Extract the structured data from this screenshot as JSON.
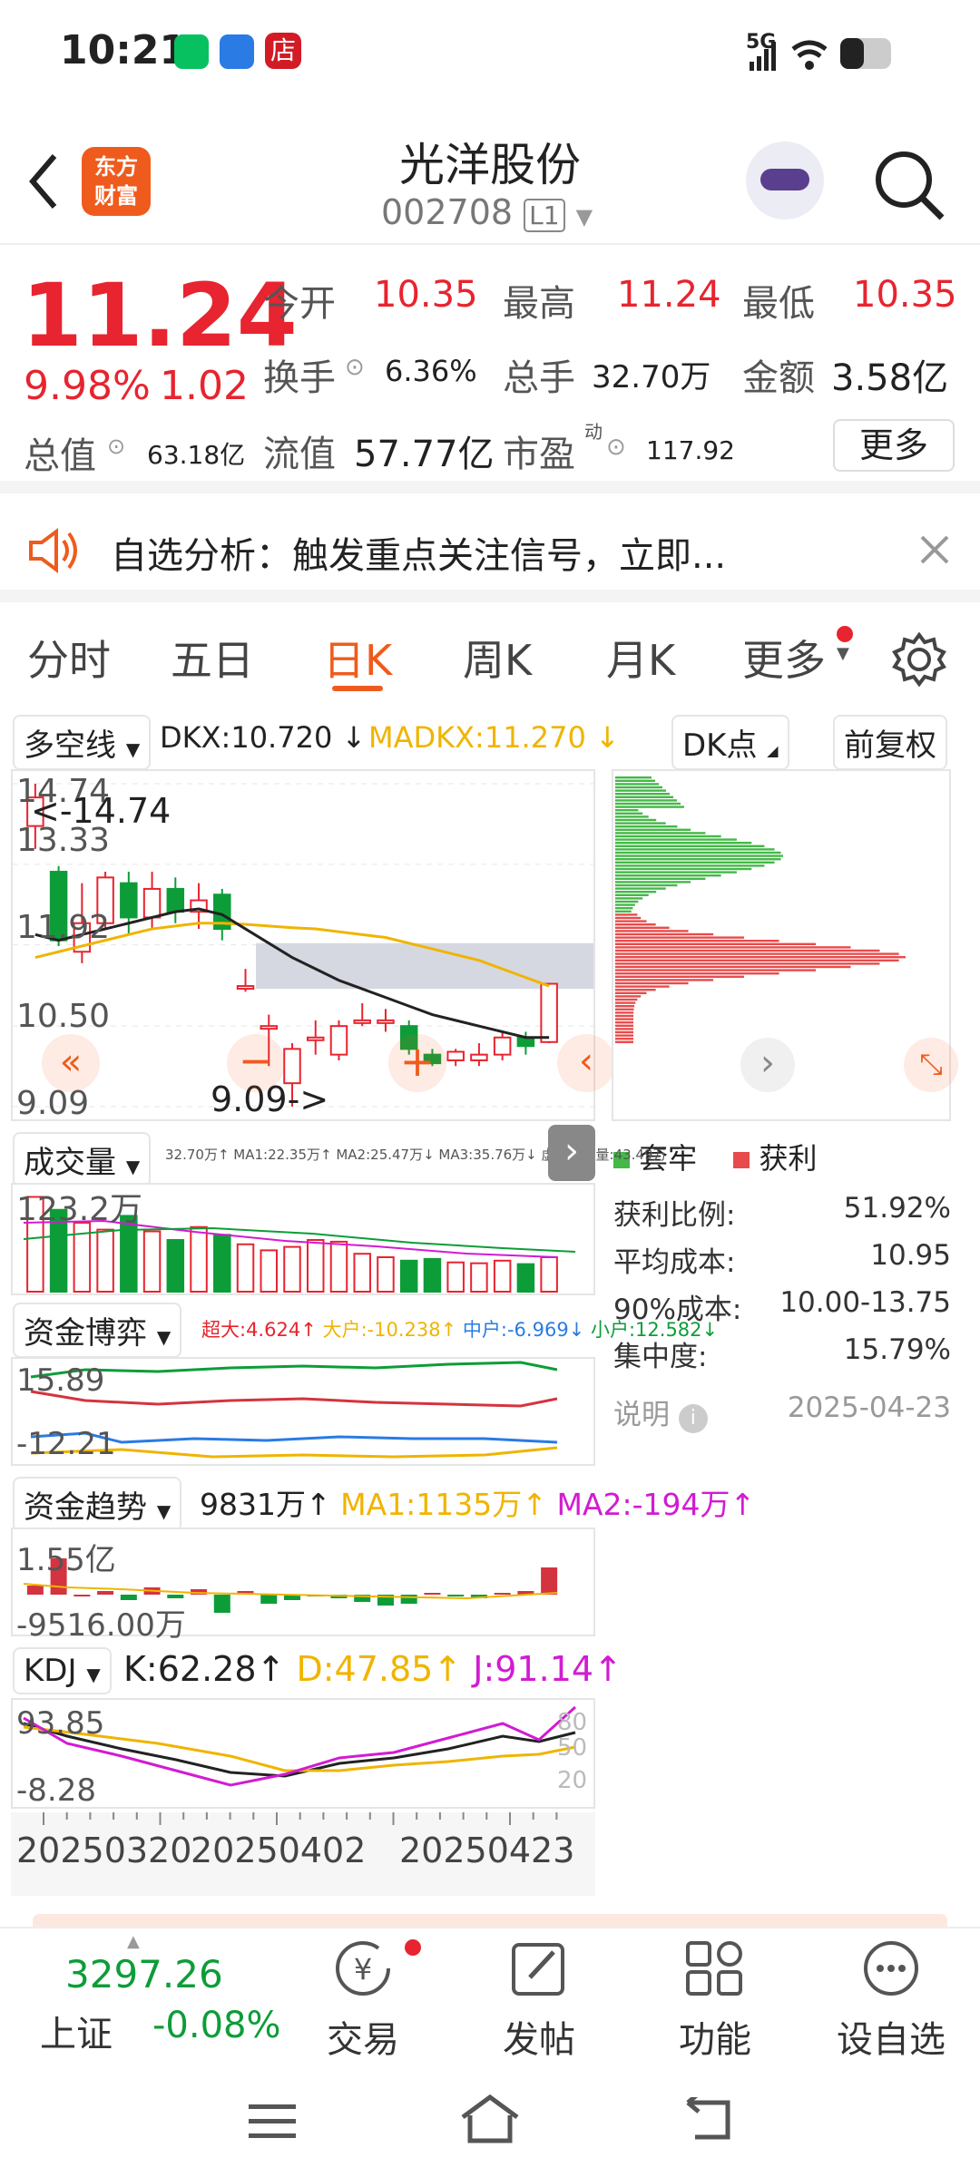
{
  "status": {
    "time": "10:21",
    "network": "5G"
  },
  "header": {
    "brand_line1": "东方",
    "brand_line2": "财富",
    "name": "光洋股份",
    "code": "002708",
    "level": "L1"
  },
  "quote": {
    "price": "11.24",
    "pct": "9.98%",
    "chg": "1.02",
    "open_label": "今开",
    "open": "10.35",
    "high_label": "最高",
    "high": "11.24",
    "low_label": "最低",
    "low": "10.35",
    "turnover_label": "换手",
    "turnover": "6.36%",
    "volume_label": "总手",
    "volume": "32.70万",
    "amount_label": "金额",
    "amount": "3.58亿",
    "mktcap_label": "总值",
    "mktcap": "63.18亿",
    "float_label": "流值",
    "float": "57.77亿",
    "pe_label": "市盈",
    "pe_sup": "动",
    "pe": "117.92",
    "more": "更多"
  },
  "notice": {
    "text": "自选分析：触发重点关注信号，立即..."
  },
  "tabs": [
    "分时",
    "五日",
    "日K",
    "周K",
    "月K",
    "更多"
  ],
  "kline": {
    "indicator": "多空线",
    "dkx": "DKX:10.720 ↓",
    "madkx": "MADKX:11.270 ↓",
    "dk_point": "DK点",
    "adjust": "前复权",
    "y_top": "14.74",
    "y_2": "13.33",
    "y_3": "11.92",
    "y_4": "10.50",
    "y_bottom": "9.09",
    "hi_marker": "<-14.74",
    "lo_marker": "9.09->",
    "watermark": "东方财富"
  },
  "chart_data": {
    "type": "candlestick",
    "ylim": [
      9.09,
      14.74
    ],
    "candles": [
      {
        "o": 14.0,
        "c": 14.5,
        "h": 14.74,
        "l": 13.6
      },
      {
        "o": 13.2,
        "c": 12.0,
        "h": 13.3,
        "l": 11.9
      },
      {
        "o": 11.8,
        "c": 12.3,
        "h": 13.0,
        "l": 11.6
      },
      {
        "o": 12.3,
        "c": 13.1,
        "h": 13.2,
        "l": 12.2
      },
      {
        "o": 13.0,
        "c": 12.4,
        "h": 13.2,
        "l": 12.1
      },
      {
        "o": 12.4,
        "c": 12.9,
        "h": 13.2,
        "l": 12.2
      },
      {
        "o": 12.9,
        "c": 12.5,
        "h": 13.1,
        "l": 12.3
      },
      {
        "o": 12.5,
        "c": 12.7,
        "h": 13.0,
        "l": 12.2
      },
      {
        "o": 12.8,
        "c": 12.2,
        "h": 12.9,
        "l": 12.0
      },
      {
        "o": 11.2,
        "c": 11.2,
        "h": 11.5,
        "l": 11.1
      },
      {
        "o": 10.5,
        "c": 10.5,
        "h": 10.7,
        "l": 9.8
      },
      {
        "o": 9.5,
        "c": 10.1,
        "h": 10.2,
        "l": 9.09
      },
      {
        "o": 10.3,
        "c": 10.3,
        "h": 10.6,
        "l": 10.0
      },
      {
        "o": 10.0,
        "c": 10.5,
        "h": 10.6,
        "l": 9.9
      },
      {
        "o": 10.6,
        "c": 10.6,
        "h": 10.9,
        "l": 10.5
      },
      {
        "o": 10.6,
        "c": 10.6,
        "h": 10.8,
        "l": 10.4
      },
      {
        "o": 10.5,
        "c": 10.1,
        "h": 10.6,
        "l": 10.0
      },
      {
        "o": 10.0,
        "c": 9.85,
        "h": 10.1,
        "l": 9.8
      },
      {
        "o": 9.9,
        "c": 10.05,
        "h": 10.1,
        "l": 9.8
      },
      {
        "o": 9.9,
        "c": 10.0,
        "h": 10.2,
        "l": 9.8
      },
      {
        "o": 10.0,
        "c": 10.3,
        "h": 10.4,
        "l": 9.9
      },
      {
        "o": 10.3,
        "c": 10.15,
        "h": 10.4,
        "l": 10.0
      },
      {
        "o": 10.22,
        "c": 11.24,
        "h": 11.24,
        "l": 10.2
      }
    ],
    "dkx_line": [
      12.1,
      12.0,
      12.1,
      12.2,
      12.3,
      12.4,
      12.5,
      12.55,
      12.45,
      12.2,
      11.95,
      11.7,
      11.5,
      11.3,
      11.15,
      11.0,
      10.85,
      10.7,
      10.6,
      10.5,
      10.4,
      10.3,
      10.3
    ],
    "madkx_line": [
      11.7,
      11.8,
      11.9,
      12.0,
      12.1,
      12.2,
      12.25,
      12.3,
      12.3,
      12.28,
      12.25,
      12.22,
      12.2,
      12.15,
      12.1,
      12.05,
      11.95,
      11.85,
      11.75,
      11.65,
      11.5,
      11.35,
      11.2
    ]
  },
  "volume": {
    "label": "成交量",
    "info": "32.70万↑ MA1:22.35万↑ MA2:25.47万↓ MA3:35.76万↓ 虚拟成交量:43.49万",
    "y_top": "123.2万"
  },
  "money_game": {
    "label": "资金博弈",
    "super": "超大:4.624↑",
    "big": "大户:-10.238↑",
    "mid": "中户:-6.969↓",
    "small": "小户:12.582↓",
    "y_top": "15.89",
    "y_bottom": "-12.21"
  },
  "money_trend": {
    "label": "资金趋势",
    "val": "9831万↑",
    "ma1": "MA1:1135万↑",
    "ma2": "MA2:-194万↑",
    "y_top": "1.55亿",
    "y_bottom": "-9516.00万"
  },
  "kdj": {
    "label": "KDJ",
    "k": "K:62.28↑",
    "d": "D:47.85↑",
    "j": "J:91.14↑",
    "y_top": "93.85",
    "y_bottom": "-8.28",
    "r80": "80",
    "r50": "50",
    "r20": "20"
  },
  "dates": [
    "20250320",
    "20250402",
    "20250423"
  ],
  "chip": {
    "legend_trap": "套牢",
    "legend_profit": "获利",
    "rows": [
      {
        "label": "获利比例:",
        "value": "51.92%"
      },
      {
        "label": "平均成本:",
        "value": "10.95"
      },
      {
        "label": "90%成本:",
        "value": "10.00-13.75"
      },
      {
        "label": "集中度:",
        "value": "15.79%"
      },
      {
        "label": "说明",
        "value": "2025-04-23"
      }
    ]
  },
  "bottom": {
    "index_value": "3297.26",
    "index_name": "上证",
    "index_pct": "-0.08%",
    "trade": "交易",
    "post": "发帖",
    "func": "功能",
    "add": "设自选"
  },
  "colors": {
    "up": "#e7242f",
    "down": "#0d9d38",
    "accent": "#ef5b1d",
    "dkx": "#222222",
    "madkx": "#f0b400"
  }
}
